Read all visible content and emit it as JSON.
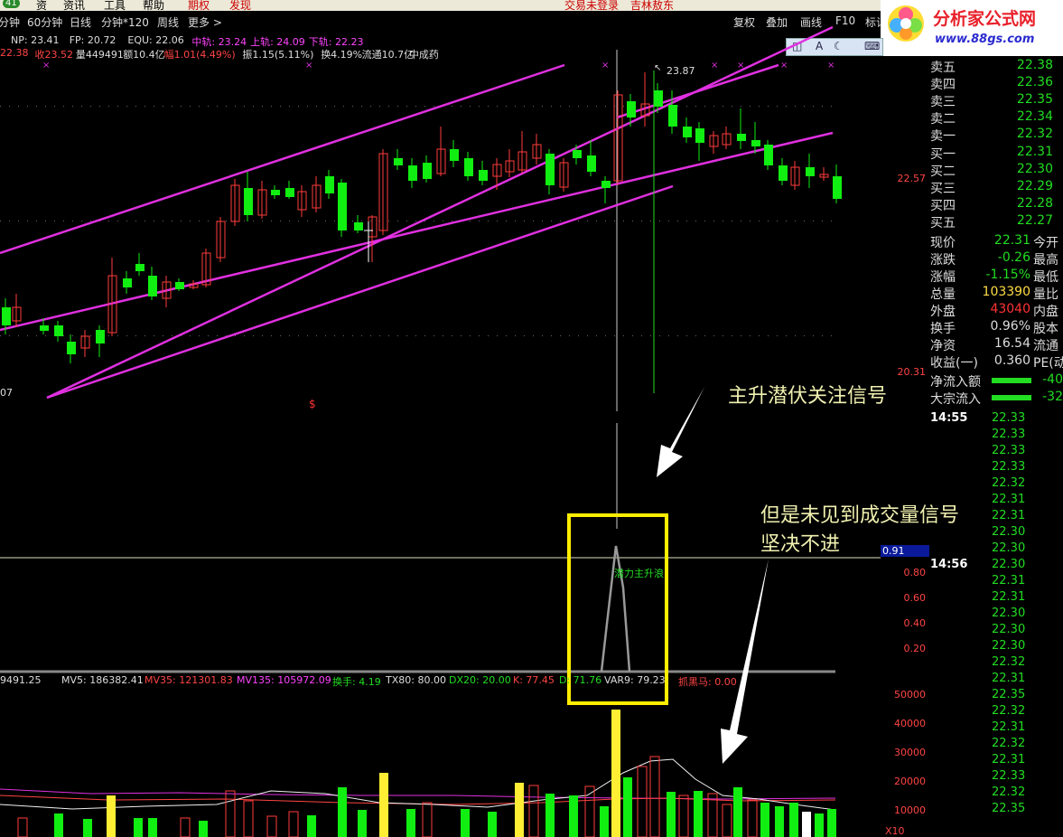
{
  "menu": {
    "left_badge": "41",
    "items": [
      "资",
      "资讯",
      "工具",
      "帮助",
      "期权",
      "发现"
    ],
    "status": [
      "交易未登录",
      "吉林敖东"
    ]
  },
  "period_tabs": [
    "分钟",
    "60分钟",
    "日线",
    "分钟*120",
    "周线",
    "更多 >"
  ],
  "right_tools": [
    "复权",
    "叠加",
    "画线",
    "F10",
    "标记"
  ],
  "logo": {
    "title": "分析家公式网",
    "url_text": "www.88gs.com"
  },
  "mini_tools": [
    "◫",
    "A",
    "☾",
    "⌨"
  ],
  "legend_line1": [
    {
      "text": "NP: 23.41",
      "color": "#dddddd"
    },
    {
      "text": "FP: 20.72",
      "color": "#dddddd"
    },
    {
      "text": "EQU: 22.06",
      "color": "#dddddd"
    },
    {
      "text": "中轨: 23.24",
      "color": "#ff44ff"
    },
    {
      "text": "上轨: 24.09",
      "color": "#ff44ff"
    },
    {
      "text": "下轨: 22.23",
      "color": "#ff44ff"
    }
  ],
  "legend_line2": [
    {
      "text": "22.38",
      "color": "#ff4444"
    },
    {
      "text": "收23.52",
      "color": "#ff4444"
    },
    {
      "text": "量449491",
      "color": "#dddddd"
    },
    {
      "text": "额10.4亿",
      "color": "#dddddd"
    },
    {
      "text": "幅1.01(4.49%)",
      "color": "#ff4444"
    },
    {
      "text": "振1.15(5.11%)",
      "color": "#dddddd"
    },
    {
      "text": "换4.19%",
      "color": "#dddddd"
    },
    {
      "text": "流通10.7亿",
      "color": "#dddddd"
    },
    {
      "text": "中成药",
      "color": "#dddddd"
    }
  ],
  "chart_labels": {
    "high_mark": "23.87",
    "left_low": "07",
    "axis_mid": "22.57",
    "axis_low": "20.31",
    "signal_mark": "$"
  },
  "annotations": {
    "top_text": "主升潜伏关注信号",
    "bottom_text_1": "但是未见到成交量信号",
    "bottom_text_2": "坚决不进"
  },
  "indicator_panel": {
    "cursor_value": "0.91",
    "axis_ticks": [
      "0.80",
      "0.60",
      "0.40",
      "0.20"
    ],
    "signal_label": "潜力主升浪",
    "legend": [
      {
        "text": "9491.25",
        "color": "#dddddd"
      },
      {
        "text": "MV5: 186382.41",
        "color": "#dddddd"
      },
      {
        "text": "MV35: 121301.83",
        "color": "#ff4444"
      },
      {
        "text": "MV135: 105972.09",
        "color": "#ff44ff"
      },
      {
        "text": "换手: 4.19",
        "color": "#22dd22"
      },
      {
        "text": "TX80: 80.00",
        "color": "#dddddd"
      },
      {
        "text": "DX20: 20.00",
        "color": "#22dd22"
      },
      {
        "text": "K: 77.45",
        "color": "#ff4444"
      },
      {
        "text": "D: 71.76",
        "color": "#22dd22"
      },
      {
        "text": "VAR9: 79.23",
        "color": "#dddddd"
      },
      {
        "text": "抓黑马: 0.00",
        "color": "#ff4444"
      }
    ]
  },
  "volume_axis": [
    "50000",
    "40000",
    "30000",
    "20000",
    "10000"
  ],
  "volume_unit": "X10",
  "quote": {
    "sell": [
      {
        "label": "卖五",
        "price": "22.38"
      },
      {
        "label": "卖四",
        "price": "22.36"
      },
      {
        "label": "卖三",
        "price": "22.35"
      },
      {
        "label": "卖二",
        "price": "22.34"
      },
      {
        "label": "卖一",
        "price": "22.32"
      }
    ],
    "buy": [
      {
        "label": "买一",
        "price": "22.31"
      },
      {
        "label": "买二",
        "price": "22.30"
      },
      {
        "label": "买三",
        "price": "22.29"
      },
      {
        "label": "买四",
        "price": "22.28"
      },
      {
        "label": "买五",
        "price": "22.27"
      }
    ],
    "stats": [
      {
        "label": "现价",
        "value": "22.31",
        "extra": "今开",
        "color": "#22dd22"
      },
      {
        "label": "涨跌",
        "value": "-0.26",
        "extra": "最高",
        "color": "#22dd22"
      },
      {
        "label": "涨幅",
        "value": "-1.15%",
        "extra": "最低",
        "color": "#22dd22"
      },
      {
        "label": "总量",
        "value": "103390",
        "extra": "量比",
        "color": "#ffdd44"
      },
      {
        "label": "外盘",
        "value": "43040",
        "extra": "内盘",
        "color": "#ff3333"
      },
      {
        "label": "换手",
        "value": "0.96%",
        "extra": "股本",
        "color": "#dddddd"
      },
      {
        "label": "净资",
        "value": "16.54",
        "extra": "流通",
        "color": "#dddddd"
      },
      {
        "label": "收益(一)",
        "value": "0.360",
        "extra": "PE(动",
        "color": "#dddddd"
      }
    ],
    "flow": [
      {
        "label": "净流入额",
        "value": "-40"
      },
      {
        "label": "大宗流入",
        "value": "-32"
      }
    ],
    "ticks": [
      {
        "time": "14:55",
        "price": "22.33"
      },
      {
        "time": "",
        "price": "22.33"
      },
      {
        "time": "",
        "price": "22.33"
      },
      {
        "time": "",
        "price": "22.33"
      },
      {
        "time": "",
        "price": "22.32"
      },
      {
        "time": "",
        "price": "22.31"
      },
      {
        "time": "",
        "price": "22.31"
      },
      {
        "time": "",
        "price": "22.30"
      },
      {
        "time": "",
        "price": "22.30"
      },
      {
        "time": "14:56",
        "price": "22.30"
      },
      {
        "time": "",
        "price": "22.31"
      },
      {
        "time": "",
        "price": "22.31"
      },
      {
        "time": "",
        "price": "22.30"
      },
      {
        "time": "",
        "price": "22.30"
      },
      {
        "time": "",
        "price": "22.30"
      },
      {
        "time": "",
        "price": "22.32"
      },
      {
        "time": "",
        "price": "22.31"
      },
      {
        "time": "",
        "price": "22.35"
      },
      {
        "time": "",
        "price": "22.32"
      },
      {
        "time": "",
        "price": "22.31"
      },
      {
        "time": "",
        "price": "22.32"
      },
      {
        "time": "",
        "price": "22.31"
      },
      {
        "time": "",
        "price": "22.33"
      },
      {
        "time": "",
        "price": "22.32"
      },
      {
        "time": "",
        "price": "22.35"
      }
    ]
  },
  "colors": {
    "up": "#ff3b3b",
    "down": "#11ee11",
    "channel": "#e030e0",
    "highlight_box": "#ffee00",
    "background": "#000000"
  }
}
